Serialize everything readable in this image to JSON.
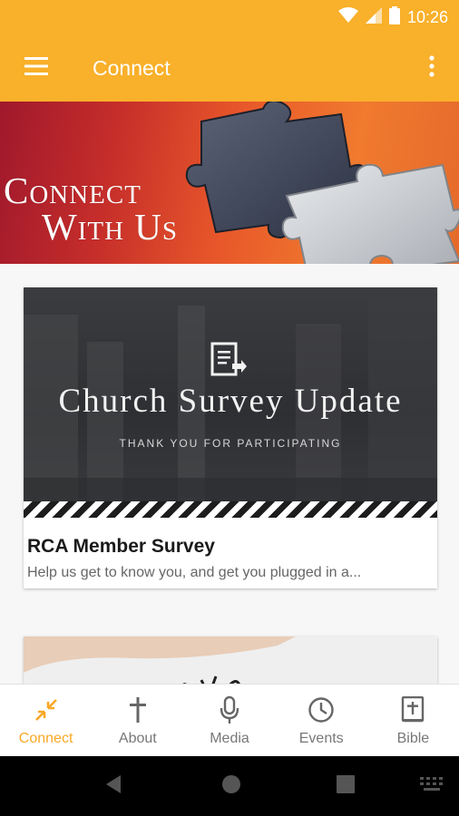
{
  "status_bar": {
    "time": "10:26"
  },
  "app_bar": {
    "title": "Connect"
  },
  "hero": {
    "line1": "Connect",
    "line2": "With Us"
  },
  "cards": [
    {
      "image_title": "Church Survey Update",
      "image_subtitle": "THANK YOU FOR PARTICIPATING",
      "title": "RCA Member Survey",
      "description": "Help us get to know you, and get you plugged in a..."
    }
  ],
  "bottom_nav": [
    {
      "label": "Connect",
      "icon": "connect-arrows-icon",
      "active": true
    },
    {
      "label": "About",
      "icon": "cross-icon",
      "active": false
    },
    {
      "label": "Media",
      "icon": "microphone-icon",
      "active": false
    },
    {
      "label": "Events",
      "icon": "clock-icon",
      "active": false
    },
    {
      "label": "Bible",
      "icon": "bible-icon",
      "active": false
    }
  ],
  "colors": {
    "accent": "#f9b02a",
    "active_nav": "#f9a825",
    "inactive_nav": "#777777"
  }
}
